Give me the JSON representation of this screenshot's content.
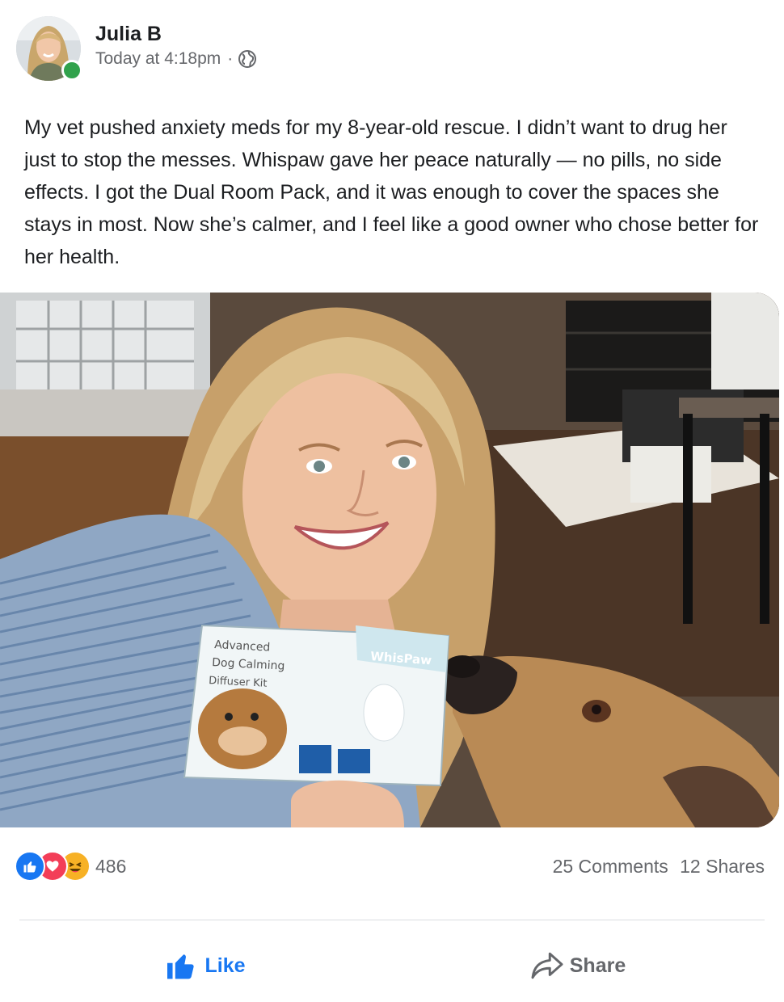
{
  "post": {
    "author": "Julia B",
    "timestamp": "Today at 4:18pm",
    "separator": "·",
    "privacy_icon": "globe-icon",
    "text": "My vet pushed anxiety meds for my 8-year-old rescue. I didn’t want to drug her just to stop the messes. Whispaw gave her peace naturally — no pills, no side effects. I got the Dual Room Pack, and it was enough to cover the spaces she stays in most. Now she’s calmer, and I feel like a good owner who chose better for her health."
  },
  "photo": {
    "box_title_line1": "Advanced",
    "box_title_line2": "Dog Calming",
    "box_title_line3": "Diffuser Kit",
    "box_brand": "WhisPaw"
  },
  "stats": {
    "reaction_icons": [
      "like-icon",
      "love-icon",
      "haha-icon"
    ],
    "reaction_count": "486",
    "comments": "25 Comments",
    "shares": "12 Shares"
  },
  "actions": {
    "like_label": "Like",
    "share_label": "Share"
  },
  "colors": {
    "accent": "#1877f2",
    "secondary_text": "#65676b",
    "online": "#31a24c",
    "love": "#f33e58",
    "haha": "#f7b125"
  }
}
